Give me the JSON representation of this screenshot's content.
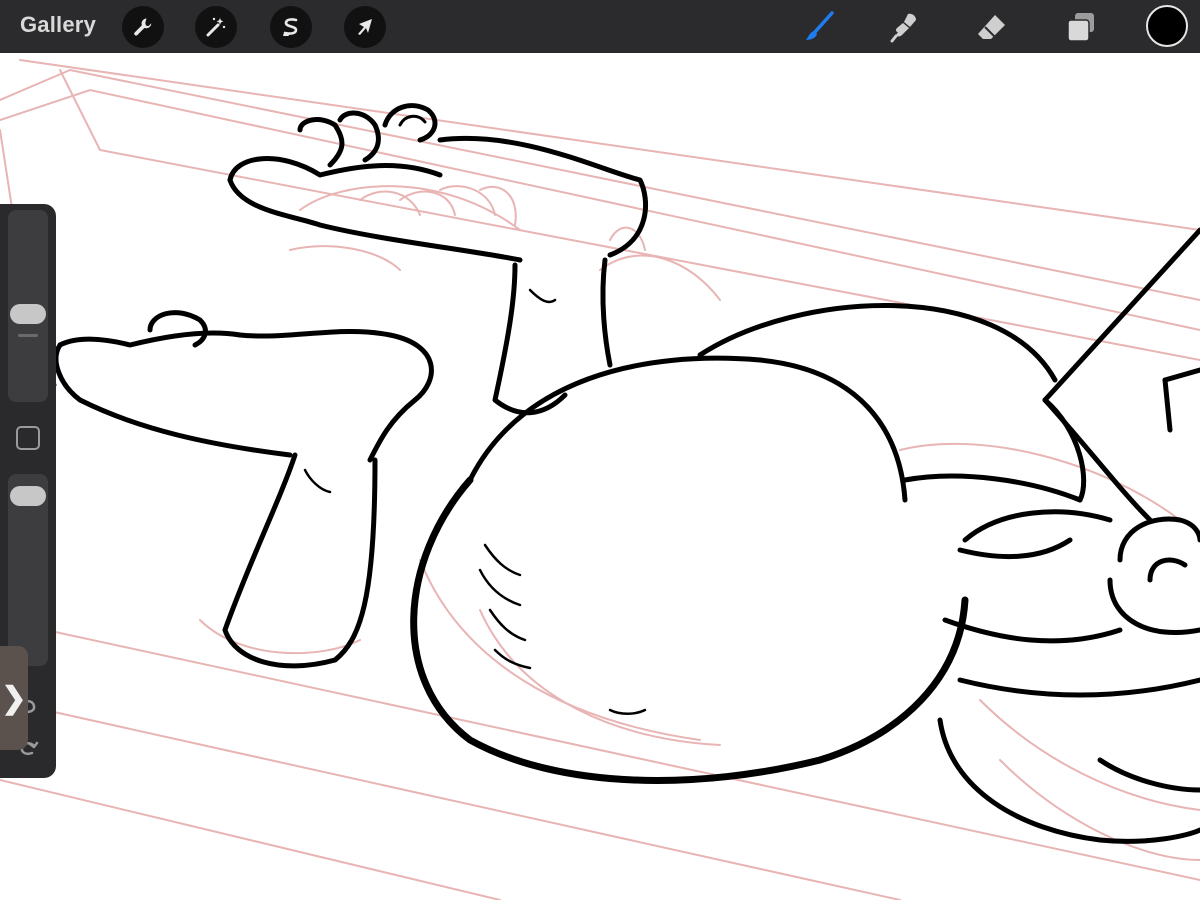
{
  "toolbar": {
    "gallery_label": "Gallery",
    "left_tools": [
      {
        "name": "actions",
        "icon": "wrench-icon"
      },
      {
        "name": "adjustments",
        "icon": "magic-wand-icon"
      },
      {
        "name": "selection",
        "icon": "selection-s-icon"
      },
      {
        "name": "transform",
        "icon": "arrow-cursor-icon"
      }
    ],
    "right_tools": [
      {
        "name": "brush",
        "icon": "brush-icon",
        "active": true
      },
      {
        "name": "smudge",
        "icon": "smudge-icon",
        "active": false
      },
      {
        "name": "eraser",
        "icon": "eraser-icon",
        "active": false
      },
      {
        "name": "layers",
        "icon": "layers-icon",
        "active": false
      }
    ],
    "current_color": "#000000"
  },
  "sidebar": {
    "brush_size_level": 0.45,
    "opacity_level": 0.95,
    "modify_icon": "square-icon",
    "undo_icon": "undo-icon",
    "redo_icon": "redo-icon",
    "expand_icon": "chevron-right-icon"
  },
  "colors": {
    "toolbar_bg": "#2b2b2d",
    "active_tool": "#1e7cf0",
    "sketch_layer": "#e8b4b4",
    "ink_layer": "#000000"
  }
}
